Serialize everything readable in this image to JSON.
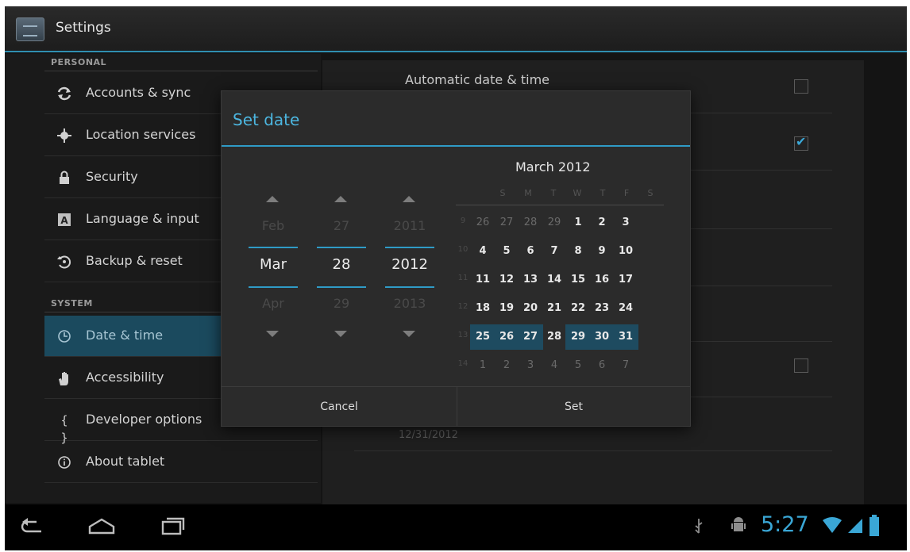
{
  "app": {
    "title": "Settings"
  },
  "sidebar": {
    "personal_header": "PERSONAL",
    "system_header": "SYSTEM",
    "items": [
      {
        "label": "Accounts & sync",
        "icon": "sync-icon"
      },
      {
        "label": "Location services",
        "icon": "location-icon"
      },
      {
        "label": "Security",
        "icon": "lock-icon"
      },
      {
        "label": "Language & input",
        "icon": "keyboard-icon"
      },
      {
        "label": "Backup & reset",
        "icon": "backup-icon"
      },
      {
        "label": "Date & time",
        "icon": "clock-icon",
        "selected": true
      },
      {
        "label": "Accessibility",
        "icon": "hand-icon"
      },
      {
        "label": "Developer options",
        "icon": "braces-icon"
      },
      {
        "label": "About tablet",
        "icon": "info-icon"
      }
    ]
  },
  "pane": {
    "auto_label": "Automatic date & time",
    "format_value": "12/31/2012"
  },
  "dialog": {
    "title": "Set date",
    "spinners": {
      "month": {
        "prev": "Feb",
        "current": "Mar",
        "next": "Apr"
      },
      "day": {
        "prev": "27",
        "current": "28",
        "next": "29"
      },
      "year": {
        "prev": "2011",
        "current": "2012",
        "next": "2013"
      }
    },
    "calendar": {
      "month_title": "March 2012",
      "weekdays": [
        "S",
        "M",
        "T",
        "W",
        "T",
        "F",
        "S"
      ],
      "weeks": [
        {
          "num": "9",
          "days": [
            "26",
            "27",
            "28",
            "29",
            "1",
            "2",
            "3"
          ]
        },
        {
          "num": "10",
          "days": [
            "4",
            "5",
            "6",
            "7",
            "8",
            "9",
            "10"
          ]
        },
        {
          "num": "11",
          "days": [
            "11",
            "12",
            "13",
            "14",
            "15",
            "16",
            "17"
          ]
        },
        {
          "num": "12",
          "days": [
            "18",
            "19",
            "20",
            "21",
            "22",
            "23",
            "24"
          ]
        },
        {
          "num": "13",
          "days": [
            "25",
            "26",
            "27",
            "28",
            "29",
            "30",
            "31"
          ]
        },
        {
          "num": "14",
          "days": [
            "1",
            "2",
            "3",
            "4",
            "5",
            "6",
            "7"
          ]
        }
      ]
    },
    "cancel_label": "Cancel",
    "set_label": "Set"
  },
  "navbar": {
    "clock": "5:27"
  },
  "colors": {
    "accent": "#3aa7d6",
    "selected_bg": "#1b4a5e"
  }
}
